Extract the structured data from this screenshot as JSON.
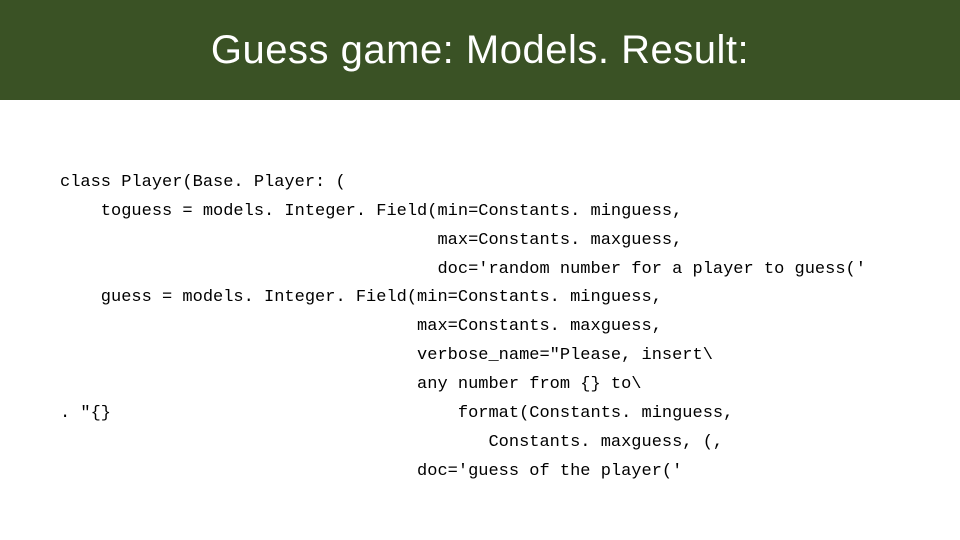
{
  "title": "Guess game: Models. Result:",
  "code": {
    "l01": "class Player(Base. Player: (",
    "l02": "    toguess = models. Integer. Field(min=Constants. minguess,",
    "l03": "                                     max=Constants. maxguess,",
    "l04": "                                     doc='random number for a player to guess('",
    "l05": "    guess = models. Integer. Field(min=Constants. minguess,",
    "l06": "                                   max=Constants. maxguess,",
    "l07": "                                   verbose_name=\"Please, insert\\",
    "l08": "                                   any number from {} to\\",
    "l09": ". \"{}                                  format(Constants. minguess,",
    "l10": "                                          Constants. maxguess, (,",
    "l11": "                                   doc='guess of the player('"
  }
}
